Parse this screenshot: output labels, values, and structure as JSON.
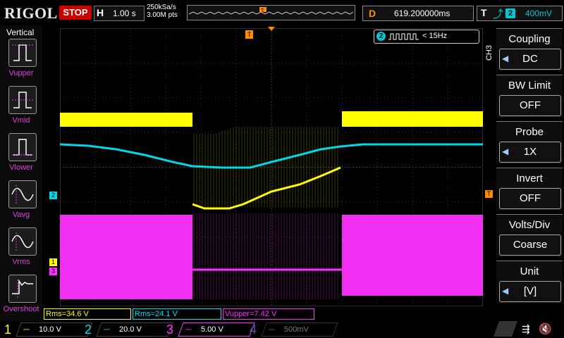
{
  "topbar": {
    "brand": "RIGOL",
    "run_state": "STOP",
    "timebase_label": "H",
    "timebase_value": "1.00 s",
    "sample_rate": "250kSa/s",
    "memory_depth": "3.00M pts",
    "delay_label": "D",
    "delay_value": "619.200000ms",
    "trigger_label": "T",
    "trigger_source": "2",
    "trigger_level": "400mV"
  },
  "left_menu": {
    "title": "Vertical",
    "items": [
      {
        "label": "Vupper",
        "icon": "vupper-icon"
      },
      {
        "label": "Vmid",
        "icon": "vmid-icon"
      },
      {
        "label": "Vlower",
        "icon": "vlower-icon"
      },
      {
        "label": "Vavg",
        "icon": "vavg-icon"
      },
      {
        "label": "Vrms",
        "icon": "vrms-icon"
      },
      {
        "label": "Overshoot",
        "icon": "overshoot-icon"
      }
    ]
  },
  "right_menu": {
    "channel_tag": "CH3",
    "items": [
      {
        "title": "Coupling",
        "value": "DC"
      },
      {
        "title": "BW Limit",
        "value": "OFF"
      },
      {
        "title": "Probe",
        "value": "1X"
      },
      {
        "title": "Invert",
        "value": "OFF"
      },
      {
        "title": "Volts/Div",
        "value": "Coarse"
      },
      {
        "title": "Unit",
        "value": "[V]"
      }
    ]
  },
  "frequency_counter": {
    "channel": "2",
    "value": "< 15Hz"
  },
  "readouts": [
    {
      "text": "Rms=34.6 V",
      "color": "#ffff00"
    },
    {
      "text": "Rms=24.1 V",
      "color": "#00e0f0"
    },
    {
      "text": "Vupper=7.42 V",
      "color": "#ff30ff"
    }
  ],
  "channels": [
    {
      "num": "1",
      "scale": "10.0 V",
      "color": "#ffff00"
    },
    {
      "num": "2",
      "scale": "20.0 V",
      "color": "#00d8e8"
    },
    {
      "num": "3",
      "scale": "5.00 V",
      "color": "#ff30ff"
    },
    {
      "num": "4",
      "scale": "500mV",
      "color": "#4a4a8a"
    }
  ],
  "colors": {
    "ch1": "#ffff00",
    "ch2": "#00d8e8",
    "ch3": "#ff30ff",
    "trigger": "#ff8c00"
  },
  "markers": {
    "ch1": "1",
    "ch2": "2",
    "ch3": "3",
    "trigger_pos": "T"
  }
}
